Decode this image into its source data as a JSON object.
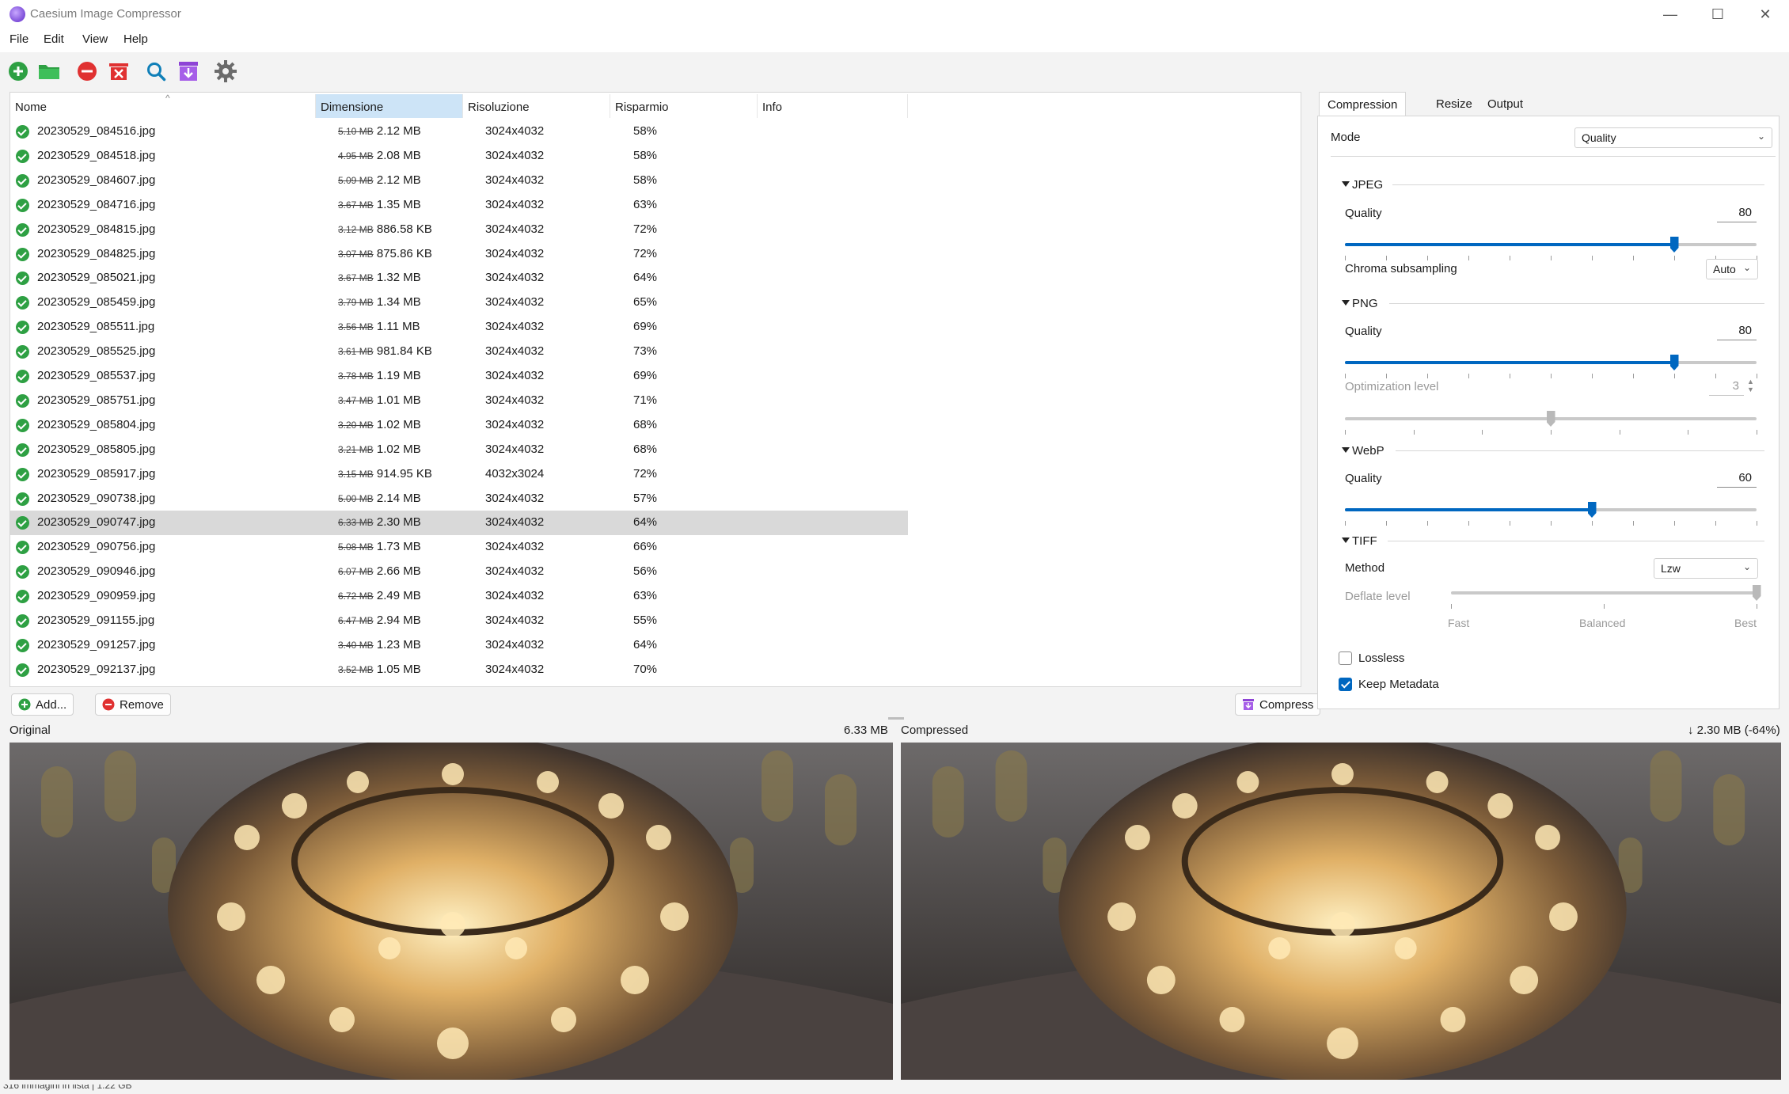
{
  "window": {
    "title": "Caesium Image Compressor",
    "controls": [
      "minimize-icon",
      "maximize-icon",
      "close-icon"
    ]
  },
  "menu": {
    "file": "File",
    "edit": "Edit",
    "view": "View",
    "help": "Help"
  },
  "toolbar": {
    "icons": [
      "add-icon",
      "folder-open-icon",
      "remove-icon",
      "clear-list-icon",
      "search-icon",
      "compress-icon",
      "settings-icon"
    ]
  },
  "table": {
    "columns": {
      "name": "Nome",
      "size": "Dimensione",
      "resolution": "Risoluzione",
      "saving": "Risparmio",
      "info": "Info"
    },
    "rows": [
      {
        "name": "20230529_084516.jpg",
        "original": "5.10 MB",
        "compressed": "2.12 MB",
        "resolution": "3024x4032",
        "saving": "58%"
      },
      {
        "name": "20230529_084518.jpg",
        "original": "4.95 MB",
        "compressed": "2.08 MB",
        "resolution": "3024x4032",
        "saving": "58%"
      },
      {
        "name": "20230529_084607.jpg",
        "original": "5.09 MB",
        "compressed": "2.12 MB",
        "resolution": "3024x4032",
        "saving": "58%"
      },
      {
        "name": "20230529_084716.jpg",
        "original": "3.67 MB",
        "compressed": "1.35 MB",
        "resolution": "3024x4032",
        "saving": "63%"
      },
      {
        "name": "20230529_084815.jpg",
        "original": "3.12 MB",
        "compressed": "886.58 KB",
        "resolution": "3024x4032",
        "saving": "72%"
      },
      {
        "name": "20230529_084825.jpg",
        "original": "3.07 MB",
        "compressed": "875.86 KB",
        "resolution": "3024x4032",
        "saving": "72%"
      },
      {
        "name": "20230529_085021.jpg",
        "original": "3.67 MB",
        "compressed": "1.32 MB",
        "resolution": "3024x4032",
        "saving": "64%"
      },
      {
        "name": "20230529_085459.jpg",
        "original": "3.79 MB",
        "compressed": "1.34 MB",
        "resolution": "3024x4032",
        "saving": "65%"
      },
      {
        "name": "20230529_085511.jpg",
        "original": "3.56 MB",
        "compressed": "1.11 MB",
        "resolution": "3024x4032",
        "saving": "69%"
      },
      {
        "name": "20230529_085525.jpg",
        "original": "3.61 MB",
        "compressed": "981.84 KB",
        "resolution": "3024x4032",
        "saving": "73%"
      },
      {
        "name": "20230529_085537.jpg",
        "original": "3.78 MB",
        "compressed": "1.19 MB",
        "resolution": "3024x4032",
        "saving": "69%"
      },
      {
        "name": "20230529_085751.jpg",
        "original": "3.47 MB",
        "compressed": "1.01 MB",
        "resolution": "3024x4032",
        "saving": "71%"
      },
      {
        "name": "20230529_085804.jpg",
        "original": "3.20 MB",
        "compressed": "1.02 MB",
        "resolution": "3024x4032",
        "saving": "68%"
      },
      {
        "name": "20230529_085805.jpg",
        "original": "3.21 MB",
        "compressed": "1.02 MB",
        "resolution": "3024x4032",
        "saving": "68%"
      },
      {
        "name": "20230529_085917.jpg",
        "original": "3.15 MB",
        "compressed": "914.95 KB",
        "resolution": "4032x3024",
        "saving": "72%"
      },
      {
        "name": "20230529_090738.jpg",
        "original": "5.00 MB",
        "compressed": "2.14 MB",
        "resolution": "3024x4032",
        "saving": "57%"
      },
      {
        "name": "20230529_090747.jpg",
        "original": "6.33 MB",
        "compressed": "2.30 MB",
        "resolution": "3024x4032",
        "saving": "64%"
      },
      {
        "name": "20230529_090756.jpg",
        "original": "5.08 MB",
        "compressed": "1.73 MB",
        "resolution": "3024x4032",
        "saving": "66%"
      },
      {
        "name": "20230529_090946.jpg",
        "original": "6.07 MB",
        "compressed": "2.66 MB",
        "resolution": "3024x4032",
        "saving": "56%"
      },
      {
        "name": "20230529_090959.jpg",
        "original": "6.72 MB",
        "compressed": "2.49 MB",
        "resolution": "3024x4032",
        "saving": "63%"
      },
      {
        "name": "20230529_091155.jpg",
        "original": "6.47 MB",
        "compressed": "2.94 MB",
        "resolution": "3024x4032",
        "saving": "55%"
      },
      {
        "name": "20230529_091257.jpg",
        "original": "3.40 MB",
        "compressed": "1.23 MB",
        "resolution": "3024x4032",
        "saving": "64%"
      },
      {
        "name": "20230529_092137.jpg",
        "original": "3.52 MB",
        "compressed": "1.05 MB",
        "resolution": "3024x4032",
        "saving": "70%"
      }
    ],
    "selected_row": "20230529_090747.jpg"
  },
  "buttons": {
    "add": "Add...",
    "remove": "Remove",
    "compress": "Compress"
  },
  "panel": {
    "tabs": {
      "compression": "Compression",
      "resize": "Resize",
      "output": "Output"
    },
    "mode_label": "Mode",
    "mode_value": "Quality",
    "jpeg": {
      "title": "JPEG",
      "quality_label": "Quality",
      "quality_value": "80",
      "quality_level": 80,
      "chroma_label": "Chroma subsampling",
      "chroma_value": "Auto"
    },
    "png": {
      "title": "PNG",
      "quality_label": "Quality",
      "quality_value": "80",
      "quality_level": 80,
      "optimization_label": "Optimization level",
      "optimization_value": "3",
      "optimization_level_fraction": 0.5
    },
    "webp": {
      "title": "WebP",
      "quality_label": "Quality",
      "quality_value": "60",
      "quality_level": 60
    },
    "tiff": {
      "title": "TIFF",
      "method_label": "Method",
      "method_value": "Lzw",
      "deflate_label": "Deflate level",
      "deflate_fast": "Fast",
      "deflate_balanced": "Balanced",
      "deflate_best": "Best",
      "deflate_level_fraction": 1.0
    },
    "lossless_label": "Lossless",
    "lossless_checked": false,
    "keep_metadata_label": "Keep Metadata",
    "keep_metadata_checked": true
  },
  "preview": {
    "original_label": "Original",
    "original_size": "6.33 MB",
    "compressed_label": "Compressed",
    "compressed_size": "↓ 2.30 MB (-64%)"
  },
  "status": {
    "text": "316 immagini in lista | 1.22 GB"
  },
  "colors": {
    "accent": "#0067c0",
    "ok": "#2ea043",
    "selected_row": "#d9d9d9",
    "header_selected": "#cde4f7"
  }
}
